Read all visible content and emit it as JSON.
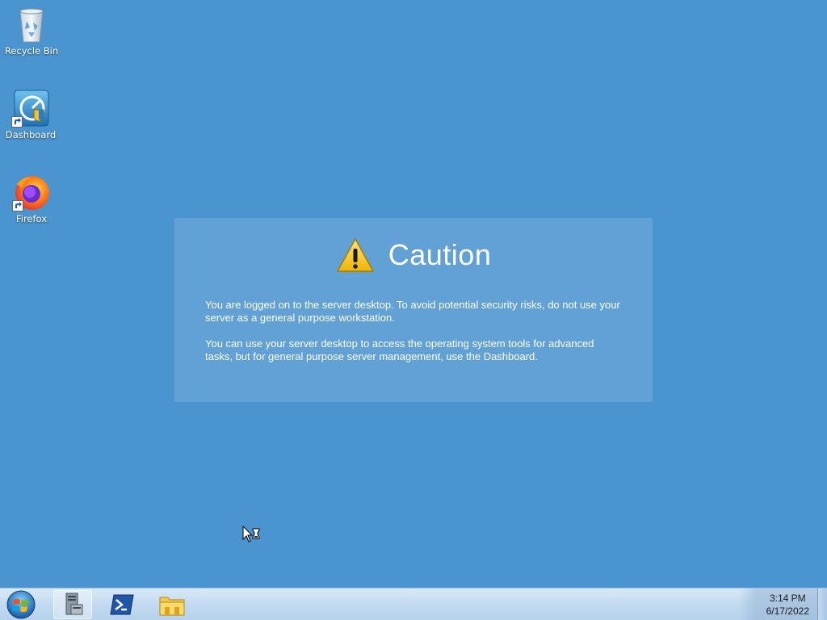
{
  "desktop": {
    "background": "#4a94d0",
    "icons": [
      {
        "label": "Recycle Bin",
        "icon": "recycle-bin-icon"
      },
      {
        "label": "Dashboard",
        "icon": "dashboard-icon"
      },
      {
        "label": "Firefox",
        "icon": "firefox-icon"
      }
    ]
  },
  "caution": {
    "title": "Caution",
    "icon": "warning-icon",
    "paragraph1": "You are logged on to the server desktop. To avoid potential security risks, do not use your server as a general purpose workstation.",
    "paragraph2": "You can use your server desktop to access the operating system tools for advanced tasks, but for general purpose server management, use the Dashboard."
  },
  "taskbar": {
    "start_icon": "windows-start-icon",
    "pinned": [
      {
        "icon": "server-manager-icon"
      },
      {
        "icon": "powershell-icon"
      },
      {
        "icon": "file-explorer-icon"
      }
    ],
    "clock": {
      "time": "3:14 PM",
      "date": "6/17/2022"
    }
  }
}
